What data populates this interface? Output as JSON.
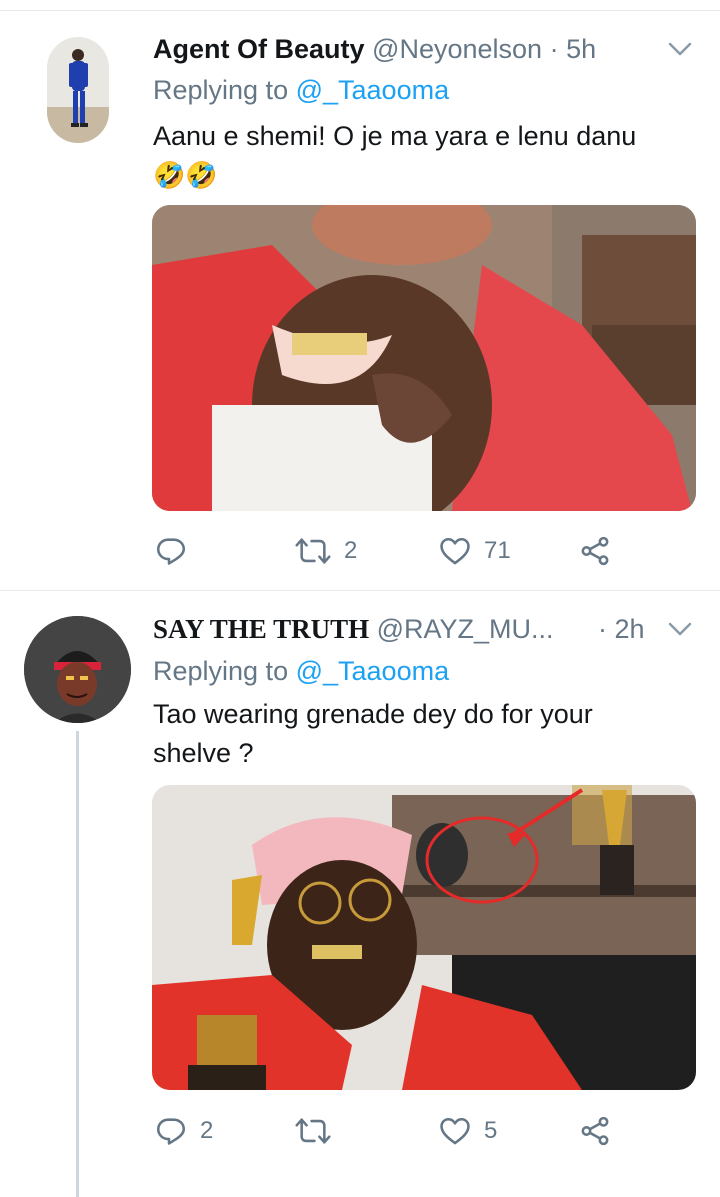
{
  "tweets": [
    {
      "name": "Agent Of Beauty",
      "handle": "@Neyonelson",
      "time": "· 5h",
      "replying_prefix": "Replying to ",
      "replying_to": "@_Taaooma",
      "text": "Aanu e shemi! O je ma yara e lenu danu",
      "emoji": "🤣🤣",
      "replies": "",
      "retweets": "2",
      "likes": "71"
    },
    {
      "name": "SAY THE TRUTH",
      "handle": "@RAYZ_MU...",
      "time": "· 2h",
      "replying_prefix": "Replying to ",
      "replying_to": "@_Taaooma",
      "text": "Tao wearing grenade dey do for your shelve ?",
      "replies": "2",
      "retweets": "",
      "likes": "5"
    }
  ],
  "colors": {
    "accent": "#1da1f2",
    "secondary_text": "#657786",
    "divider": "#e6ecf0"
  },
  "icons": [
    "chevron-down-icon",
    "reply-icon",
    "retweet-icon",
    "like-icon",
    "share-icon"
  ]
}
